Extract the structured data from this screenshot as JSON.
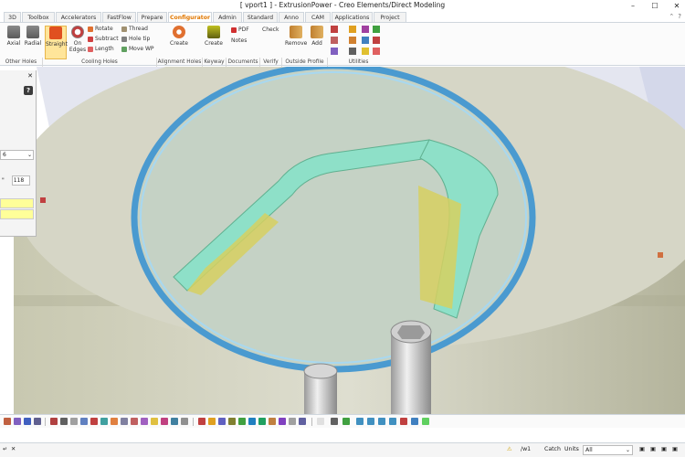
{
  "window": {
    "title": "[ vport1 ] - ExtrusionPower - Creo Elements/Direct Modeling"
  },
  "tabs": [
    {
      "label": "3D"
    },
    {
      "label": "Toolbox"
    },
    {
      "label": "Accelerators"
    },
    {
      "label": "FastFlow"
    },
    {
      "label": "Prepare"
    },
    {
      "label": "Configurator",
      "active": true
    },
    {
      "label": "Admin"
    },
    {
      "label": "Standard"
    },
    {
      "label": "Anno"
    },
    {
      "label": "CAM"
    },
    {
      "label": "Applications"
    },
    {
      "label": "Project"
    }
  ],
  "ribbon": {
    "buttons": {
      "axial": "Axial",
      "radial": "Radial",
      "straight": "Straight",
      "on_edges": "On Edges",
      "create_alignment": "Create",
      "create_keyway": "Create",
      "notes": "Notes",
      "check": "Check",
      "remove": "Remove",
      "add": "Add"
    },
    "small": {
      "rotate": "Rotate",
      "subtract": "Subtract",
      "length": "Length",
      "thread": "Thread",
      "hole_tip": "Hole tip",
      "move_wp": "Move WP",
      "pdf": "PDF"
    },
    "groups": {
      "other_holes": "Other Holes",
      "cooling_holes": "Cooling Holes",
      "alignment_holes": "Alignment Holes",
      "keyway": "Keyway",
      "documents": "Documents",
      "verify": "Verify",
      "outside_profile": "Outside Profile",
      "utilities": "Utilities"
    }
  },
  "panel": {
    "help": "?",
    "field1": "6",
    "field2_prefix": "\"",
    "field2": "118"
  },
  "status": {
    "wp": "/w1",
    "catch": "Catch",
    "units": "Units",
    "filter": "All"
  },
  "colors": {
    "accent": "#e07700",
    "mold_body": "#d8d8c4",
    "cavity": "#c8d8c8",
    "ring": "#5aa8d8",
    "insert_teal": "#7fd8c0",
    "insert_yellow": "#d8d050"
  }
}
